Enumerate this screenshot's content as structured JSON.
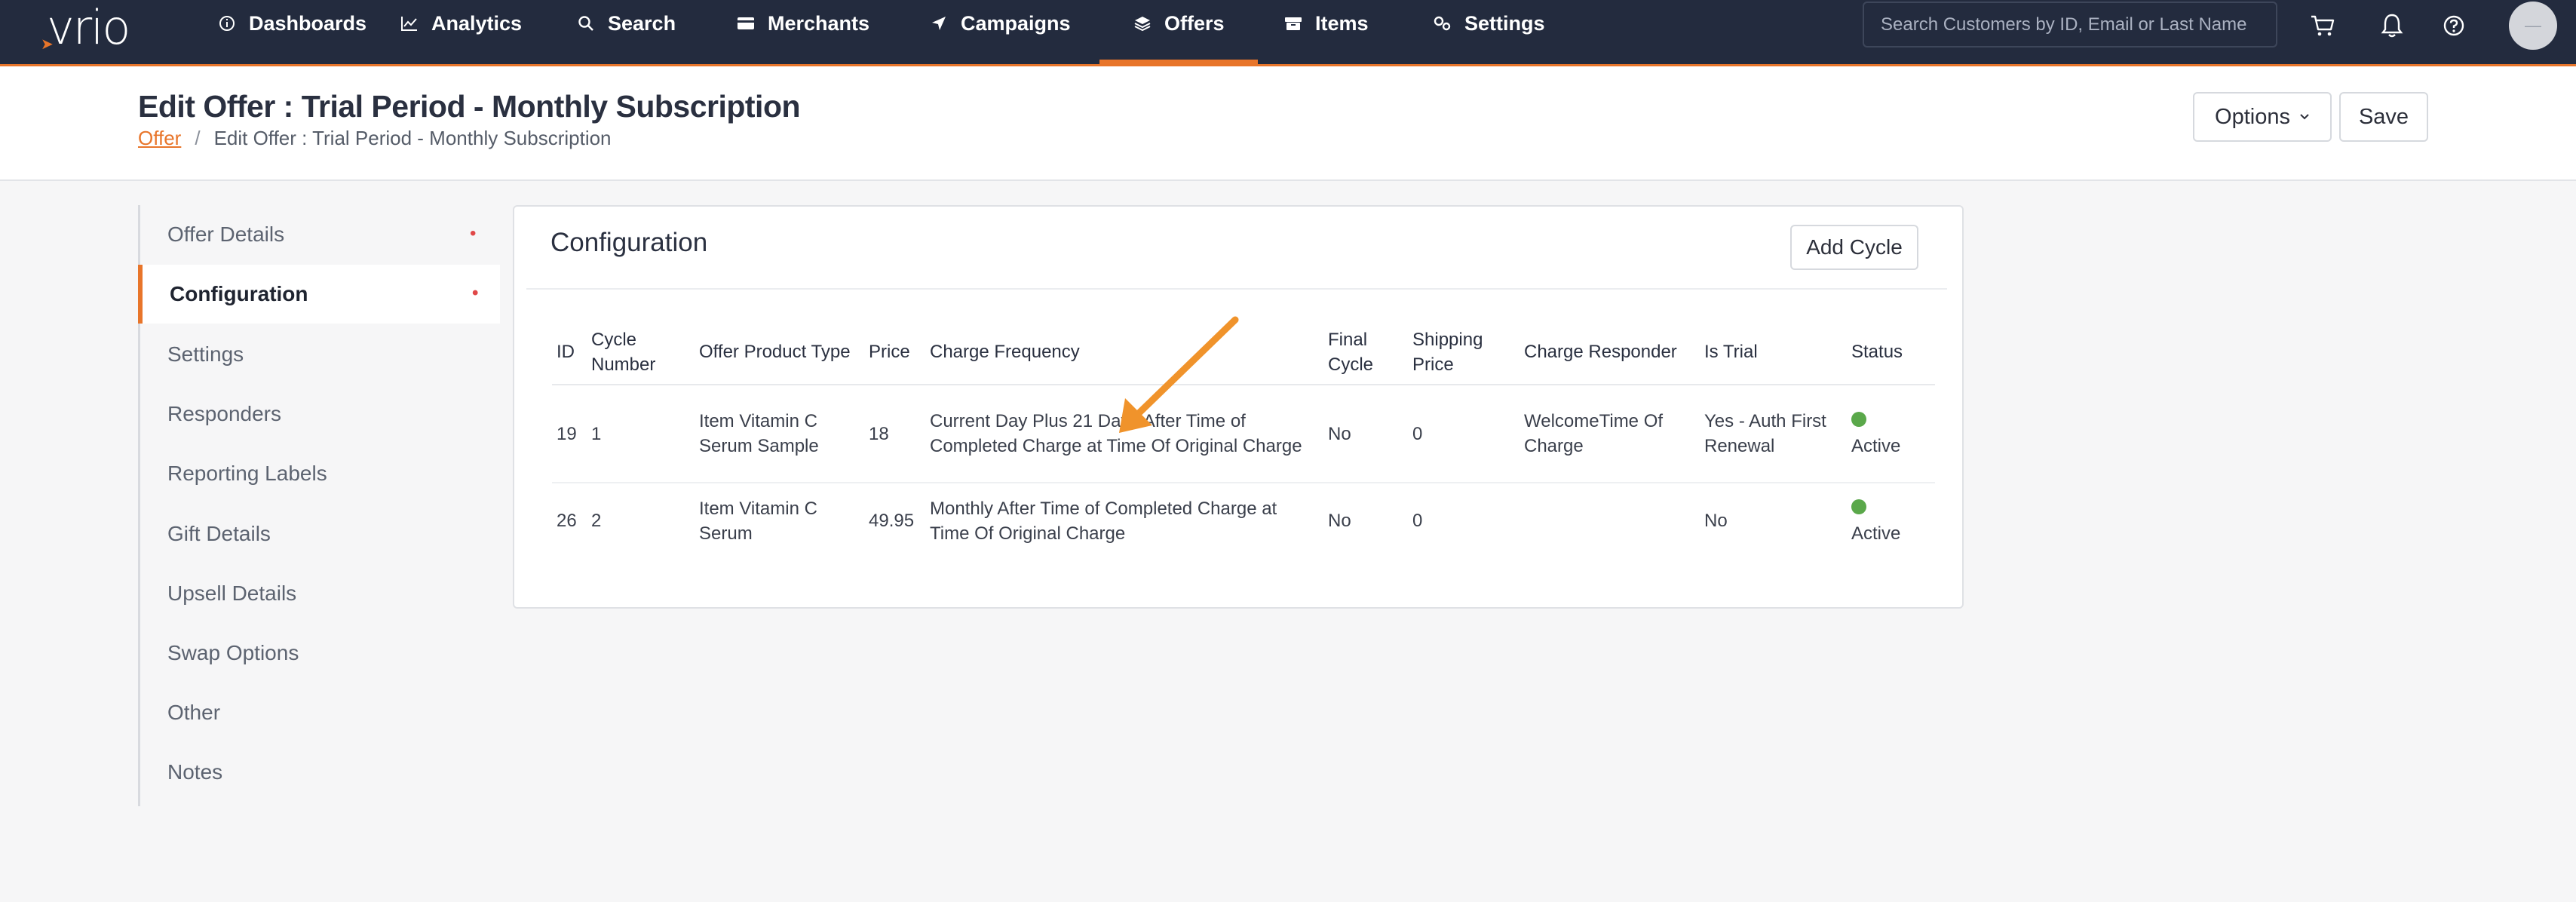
{
  "nav": {
    "logo": "vrio",
    "items": [
      {
        "label": "Dashboards",
        "icon": "info-circle-icon"
      },
      {
        "label": "Analytics",
        "icon": "line-chart-icon"
      },
      {
        "label": "Search",
        "icon": "search-icon"
      },
      {
        "label": "Merchants",
        "icon": "card-icon"
      },
      {
        "label": "Campaigns",
        "icon": "send-icon"
      },
      {
        "label": "Offers",
        "icon": "layers-icon"
      },
      {
        "label": "Items",
        "icon": "box-icon"
      },
      {
        "label": "Settings",
        "icon": "gears-icon"
      }
    ],
    "active": "Offers",
    "search_placeholder": "Search Customers by ID, Email or Last Name",
    "accent": "#e8752a",
    "bg": "#232b3e"
  },
  "header": {
    "title": "Edit Offer : Trial Period - Monthly Subscription",
    "breadcrumb_link": "Offer",
    "breadcrumb_sep": "/",
    "breadcrumb_current": "Edit Offer : Trial Period - Monthly Subscription",
    "options_label": "Options",
    "save_label": "Save"
  },
  "sidebar": {
    "items": [
      {
        "label": "Offer Details",
        "required": "•"
      },
      {
        "label": "Configuration",
        "required": "•"
      },
      {
        "label": "Settings"
      },
      {
        "label": "Responders"
      },
      {
        "label": "Reporting Labels"
      },
      {
        "label": "Gift Details"
      },
      {
        "label": "Upsell Details"
      },
      {
        "label": "Swap Options"
      },
      {
        "label": "Other"
      },
      {
        "label": "Notes"
      }
    ],
    "active": "Configuration"
  },
  "configuration": {
    "title": "Configuration",
    "add_cycle_label": "Add Cycle",
    "columns": [
      "ID",
      "Cycle Number",
      "Offer Product Type",
      "Price",
      "Charge Frequency",
      "Final Cycle",
      "Shipping Price",
      "Charge Responder",
      "Is Trial",
      "Status"
    ],
    "rows": [
      {
        "id": "19",
        "cycle_number": "1",
        "product_type": "Item Vitamin C Serum Sample",
        "price": "18",
        "charge_frequency": "Current Day Plus 21 Days After Time of Completed Charge at Time Of Original Charge",
        "final_cycle": "No",
        "shipping_price": "0",
        "charge_responder": "WelcomeTime Of Charge",
        "is_trial": "Yes - Auth First Renewal",
        "status": "Active"
      },
      {
        "id": "26",
        "cycle_number": "2",
        "product_type": "Item Vitamin C Serum",
        "price": "49.95",
        "charge_frequency": "Monthly After Time of Completed Charge at Time Of Original Charge",
        "final_cycle": "No",
        "shipping_price": "0",
        "charge_responder": "",
        "is_trial": "No",
        "status": "Active"
      }
    ],
    "status_color": "#5aa84a"
  },
  "annotation": {
    "arrow_color": "#f0932b"
  }
}
